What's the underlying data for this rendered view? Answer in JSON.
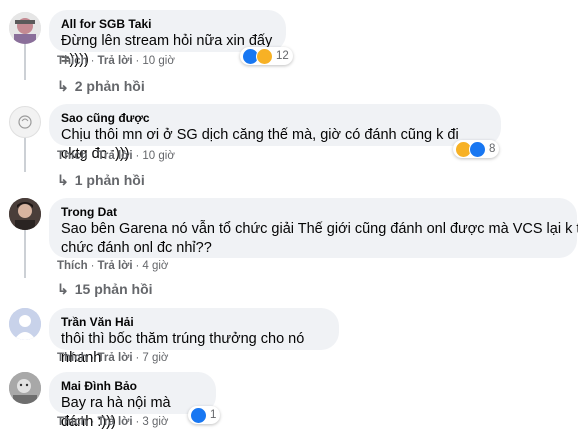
{
  "colors": {
    "bubble": "#f0f2f5",
    "meta": "#65676b",
    "like": "#1877f2",
    "haha": "#f7b125"
  },
  "comments": [
    {
      "author": "All for SGB Taki",
      "text": "Đừng lên stream hỏi nữa xin đấy =))))",
      "like_label": "Thích",
      "reply_label": "Trả lời",
      "time": "10 giờ",
      "reactions": [
        "like-icon",
        "haha-icon"
      ],
      "reaction_count": "12",
      "replies_label": "2 phản hồi"
    },
    {
      "author": "Sao cũng được",
      "text": "Chịu thôi mn ơi ở SG dịch căng thế mà, giờ có đánh cũng k đi cktg đc :)))",
      "like_label": "Thích",
      "reply_label": "Trả lời",
      "time": "10 giờ",
      "reactions": [
        "haha-icon",
        "like-icon"
      ],
      "reaction_count": "8",
      "replies_label": "1 phản hồi"
    },
    {
      "author": "Trong Dat",
      "text_line1": "Sao bên Garena nó vẫn tổ chức giải Thế giới cũng đánh onl được mà VCS lại k tổ",
      "text_line2": "chức đánh onl đc nhỉ??",
      "like_label": "Thích",
      "reply_label": "Trả lời",
      "time": "4 giờ",
      "replies_label": "15 phản hồi"
    },
    {
      "author": "Trần Văn Hải",
      "text": "thôi thì bốc thăm trúng thưởng cho nó nhanh",
      "like_label": "Thích",
      "reply_label": "Trả lời",
      "time": "7 giờ"
    },
    {
      "author": "Mai Đình Bảo",
      "text": "Bay ra hà nội mà đánh :)))",
      "like_label": "Thích",
      "reply_label": "Trả lời",
      "time": "3 giờ",
      "reactions": [
        "like-icon"
      ],
      "reaction_count": "1"
    }
  ]
}
